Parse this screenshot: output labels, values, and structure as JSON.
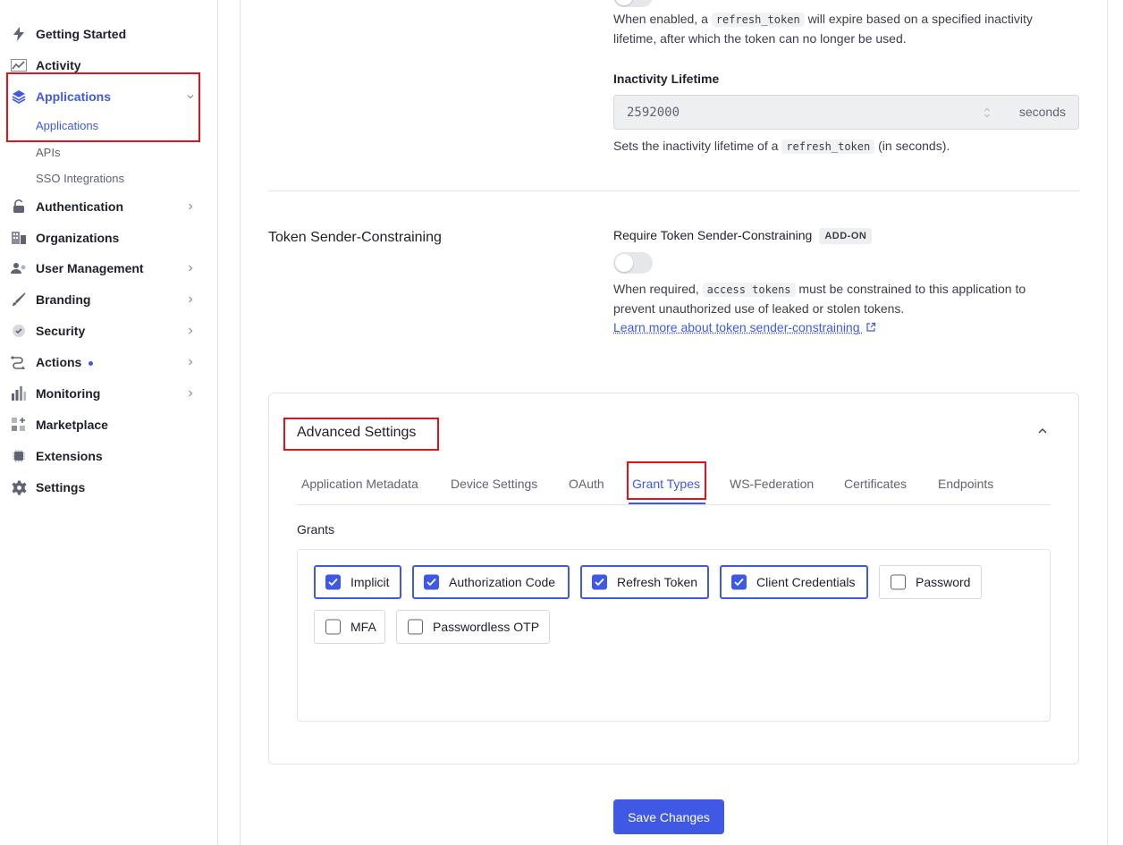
{
  "sidebar": {
    "items": [
      {
        "label": "Getting Started",
        "icon": "lightning-icon"
      },
      {
        "label": "Activity",
        "icon": "activity-chart-icon"
      },
      {
        "label": "Applications",
        "icon": "layers-icon",
        "active": true
      },
      {
        "label": "Authentication",
        "icon": "lock-icon"
      },
      {
        "label": "Organizations",
        "icon": "building-icon"
      },
      {
        "label": "User Management",
        "icon": "users-icon"
      },
      {
        "label": "Branding",
        "icon": "brush-icon"
      },
      {
        "label": "Security",
        "icon": "shield-check-icon"
      },
      {
        "label": "Actions",
        "icon": "flow-icon"
      },
      {
        "label": "Monitoring",
        "icon": "bar-chart-icon"
      },
      {
        "label": "Marketplace",
        "icon": "grid-plus-icon"
      },
      {
        "label": "Extensions",
        "icon": "chip-icon"
      },
      {
        "label": "Settings",
        "icon": "gear-icon"
      }
    ],
    "applications_sub": [
      "Applications",
      "APIs",
      "SSO Integrations"
    ]
  },
  "refresh": {
    "desc_prefix": "When enabled, a",
    "desc_code": "refresh_token",
    "desc_suffix": "will expire based on a specified inactivity",
    "desc_line2": "lifetime, after which the token can no longer be used.",
    "inactivity_label": "Inactivity Lifetime",
    "inactivity_value": "2592000",
    "inactivity_unit": "seconds",
    "help_prefix": "Sets the inactivity lifetime of a",
    "help_code": "refresh_token",
    "help_suffix": "(in seconds)."
  },
  "sender": {
    "section_title": "Token Sender-Constraining",
    "require_label": "Require Token Sender-Constraining",
    "badge": "ADD-ON",
    "desc_prefix": "When required,",
    "desc_code": "access tokens",
    "desc_suffix": "must be constrained to this application to",
    "desc_line2": "prevent unauthorized use of leaked or stolen tokens.",
    "link": "Learn more about token sender-constraining"
  },
  "advanced": {
    "title": "Advanced Settings",
    "tabs": [
      "Application Metadata",
      "Device Settings",
      "OAuth",
      "Grant Types",
      "WS-Federation",
      "Certificates",
      "Endpoints"
    ],
    "active_tab": "Grant Types",
    "grants_label": "Grants",
    "grants": [
      {
        "label": "Implicit",
        "checked": true
      },
      {
        "label": "Authorization Code",
        "checked": true
      },
      {
        "label": "Refresh Token",
        "checked": true
      },
      {
        "label": "Client Credentials",
        "checked": true
      },
      {
        "label": "Password",
        "checked": false
      },
      {
        "label": "MFA",
        "checked": false
      },
      {
        "label": "Passwordless OTP",
        "checked": false
      }
    ]
  },
  "footer": {
    "save_label": "Save Changes"
  },
  "colors": {
    "accent": "#3f59e4",
    "highlight": "#e0131c"
  }
}
